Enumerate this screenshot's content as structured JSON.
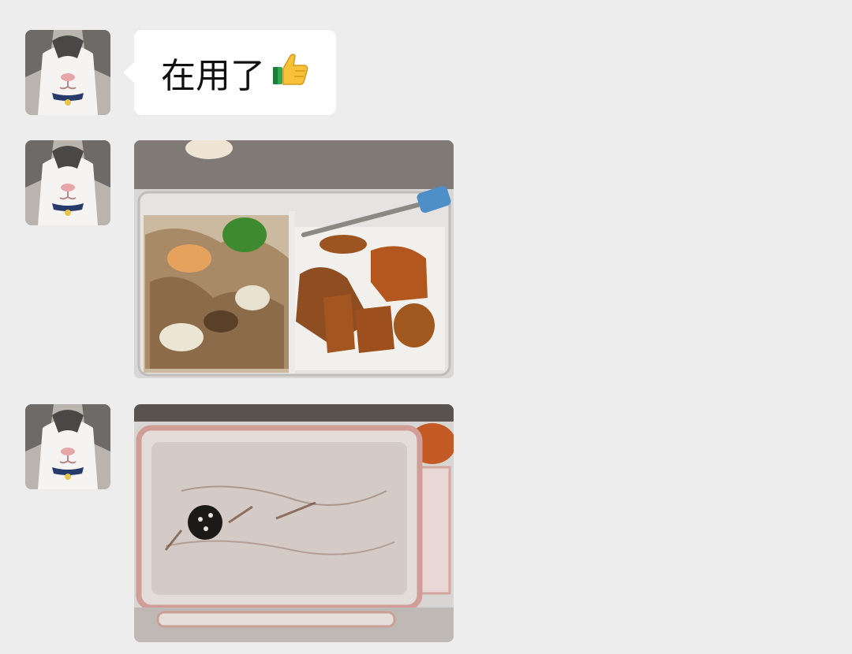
{
  "chat": {
    "messages": [
      {
        "type": "text",
        "text": "在用了",
        "emoji": "thumbs-up-emoji"
      },
      {
        "type": "image",
        "description_icon": "lunchbox-with-food-photo"
      },
      {
        "type": "image",
        "description_icon": "empty-lunchbox-photo"
      }
    ]
  },
  "colors": {
    "background": "#ededed",
    "bubble": "#ffffff",
    "text": "#111111"
  }
}
